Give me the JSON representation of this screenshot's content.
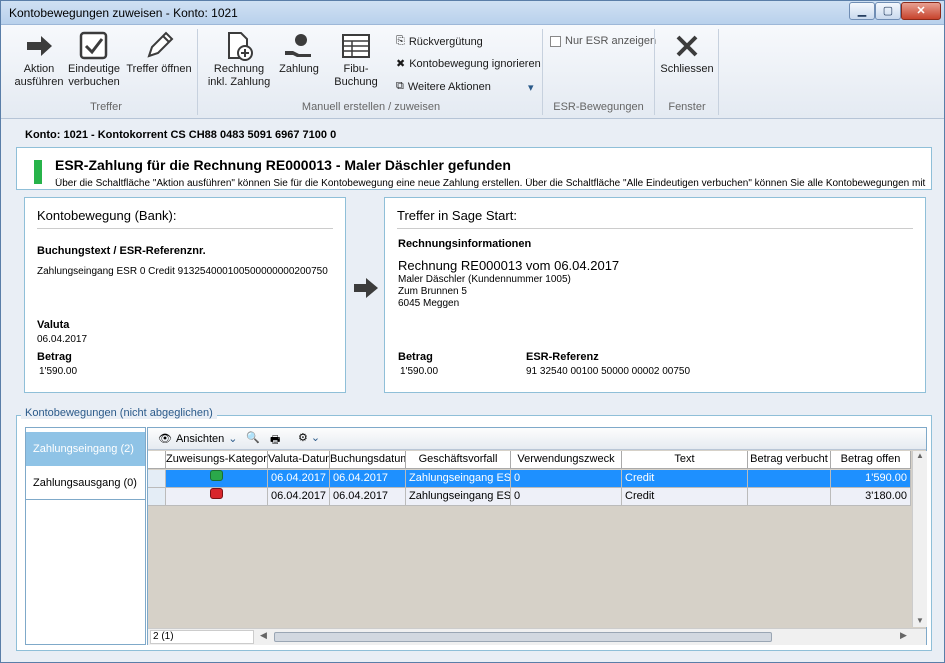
{
  "window": {
    "title": "Kontobewegungen zuweisen - Konto: 1021"
  },
  "ribbon": {
    "aktion": "Aktion ausführen",
    "eindeutige": "Eindeutige verbuchen",
    "treffer_oeffnen": "Treffer öffnen",
    "group_treffer": "Treffer",
    "rechnung": "Rechnung inkl. Zahlung",
    "zahlung": "Zahlung",
    "fibu": "Fibu-Buchung",
    "rueckverguetung": "Rückvergütung",
    "ignorieren": "Kontobewegung ignorieren",
    "weitere": "Weitere Aktionen",
    "group_manuell": "Manuell erstellen / zuweisen",
    "nur_esr": "Nur ESR anzeigen",
    "group_esr": "ESR-Bewegungen",
    "schliessen": "Schliessen",
    "group_fenster": "Fenster"
  },
  "konto_line": "Konto: 1021 - Kontokorrent CS CH88 0483 5091 6967 7100 0",
  "info": {
    "title": "ESR-Zahlung für die Rechnung RE000013 - Maler Däschler  gefunden",
    "text": "Über die Schaltfläche \"Aktion ausführen\" können Sie für die Kontobewegung eine neue Zahlung erstellen. Über die Schaltfläche \"Alle Eindeutigen verbuchen\" können Sie alle Kontobewegungen mit Status grün verbuchen."
  },
  "bank": {
    "heading": "Kontobewegung (Bank):",
    "text_label": "Buchungstext / ESR-Referenznr.",
    "text_value": "Zahlungseingang ESR 0 Credit 913254000100500000000200750",
    "valuta_label": "Valuta",
    "valuta_value": "06.04.2017",
    "betrag_label": "Betrag",
    "betrag_value": "1'590.00"
  },
  "sage": {
    "heading": "Treffer in Sage Start:",
    "section": "Rechnungsinformationen",
    "invoice": "Rechnung RE000013 vom 06.04.2017",
    "addr1": "Maler Däschler  (Kundennummer 1005)",
    "addr2": "Zum Brunnen 5",
    "addr3": "6045 Meggen",
    "betrag_label": "Betrag",
    "betrag_value": "1'590.00",
    "esr_label": "ESR-Referenz",
    "esr_value": "91 32540 00100 50000 00002 00750"
  },
  "list": {
    "legend": "Kontobewegungen (nicht abgeglichen)",
    "nav": [
      "Zahlungseingang (2)",
      "Zahlungsausgang (0)"
    ],
    "ansichten": "Ansichten",
    "columns": [
      "Zuweisungs-Kategorie",
      "Valuta-Datum",
      "Buchungsdatum",
      "Geschäftsvorfall",
      "Verwendungszweck",
      "Text",
      "Betrag verbucht",
      "Betrag offen"
    ],
    "rows": [
      {
        "status": "green",
        "valuta": "06.04.2017",
        "buchung": "06.04.2017",
        "vorfall": "Zahlungseingang ESR",
        "zweck": "0",
        "text": "Credit",
        "verbucht": "",
        "offen": "1'590.00"
      },
      {
        "status": "red",
        "valuta": "06.04.2017",
        "buchung": "06.04.2017",
        "vorfall": "Zahlungseingang ESR",
        "zweck": "0",
        "text": "Credit",
        "verbucht": "",
        "offen": "3'180.00"
      }
    ],
    "status_colors": {
      "green": "#2aa84a",
      "red": "#d8262c"
    },
    "count": "2 (1)"
  }
}
